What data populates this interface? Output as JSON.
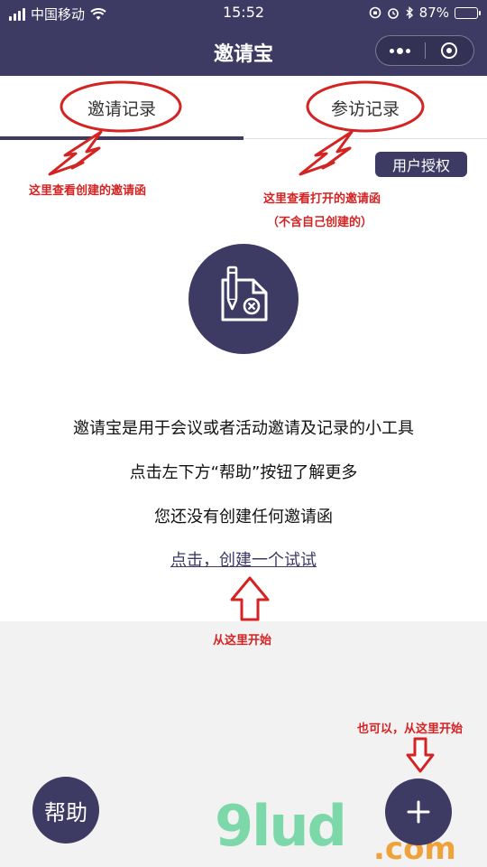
{
  "status_bar": {
    "carrier": "中国移动",
    "time": "15:52",
    "battery_percent": "87%",
    "battery_level": 0.87,
    "icons": [
      "signal-icon",
      "wifi-icon",
      "orientation-lock-icon",
      "alarm-icon",
      "bluetooth-icon",
      "battery-icon"
    ]
  },
  "nav": {
    "title": "邀请宝",
    "capsule_icons": [
      "more-dots-icon",
      "close-mini-program-icon"
    ]
  },
  "tabs": [
    {
      "label": "邀请记录",
      "active": true
    },
    {
      "label": "参访记录",
      "active": false
    }
  ],
  "auth_button": {
    "label": "用户授权"
  },
  "main": {
    "line1": "邀请宝是用于会议或者活动邀请及记录的小工具",
    "line2": "点击左下方“帮助”按钮了解更多",
    "line3": "您还没有创建任何邀请函",
    "create_link": "点击，创建一个试试"
  },
  "annotations": {
    "left_tab_note": "这里查看创建的邀请函",
    "right_tab_note": "这里查看打开的邀请函",
    "right_tab_note_sub": "（不含自己创建的）",
    "start_here": "从这里开始",
    "also_start_here": "也可以，从这里开始",
    "color": "#d42323"
  },
  "buttons": {
    "help": "帮助",
    "add_icon": "plus-icon"
  },
  "watermark": {
    "main": "9lud",
    "suffix": ".com",
    "colors": {
      "main": "#7cd8a8",
      "suffix": "#f0a23a"
    }
  },
  "colors": {
    "primary": "#3d3b63",
    "annotation": "#d42323",
    "background": "#f2f2f2"
  }
}
